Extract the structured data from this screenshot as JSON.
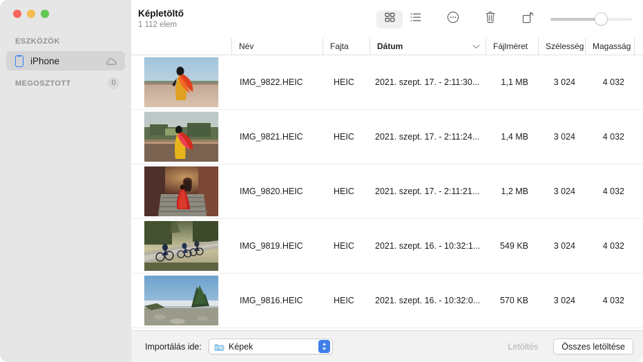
{
  "window": {
    "traffic_lights": [
      "close",
      "minimize",
      "zoom"
    ],
    "title": "Képletöltő",
    "subtitle": "1 112 elem"
  },
  "sidebar": {
    "sections": [
      {
        "label": "ESZKÖZÖK"
      },
      {
        "label": "MEGOSZTOTT",
        "badge": "0"
      }
    ],
    "device": {
      "label": "iPhone",
      "device_icon": "iphone-icon",
      "status_icon": "cloud-icon",
      "selected": true
    }
  },
  "toolbar": {
    "buttons": [
      {
        "name": "grid-view-icon",
        "active": true
      },
      {
        "name": "list-view-icon",
        "active": false
      },
      {
        "name": "more-options-icon",
        "active": false
      },
      {
        "name": "trash-icon",
        "active": false
      },
      {
        "name": "rotate-icon",
        "active": false
      }
    ],
    "zoom_slider": {
      "name": "thumbnail-size-slider",
      "value": 72
    }
  },
  "columns": [
    {
      "key": "thumb",
      "label": "",
      "sorted": false
    },
    {
      "key": "name",
      "label": "Név",
      "sorted": false
    },
    {
      "key": "kind",
      "label": "Fajta",
      "sorted": false
    },
    {
      "key": "date",
      "label": "Dátum",
      "sorted": true
    },
    {
      "key": "size",
      "label": "Fájlméret",
      "sorted": false
    },
    {
      "key": "width",
      "label": "Szélesség",
      "sorted": false
    },
    {
      "key": "height",
      "label": "Magasság",
      "sorted": false
    }
  ],
  "rows": [
    {
      "name": "IMG_9822.HEIC",
      "kind": "HEIC",
      "date": "2021. szept. 17. - 2:11:30...",
      "size": "1,1 MB",
      "width": "3 024",
      "height": "4 032",
      "thumb": "woman-red-sari-on-terrace"
    },
    {
      "name": "IMG_9821.HEIC",
      "kind": "HEIC",
      "date": "2021. szept. 17. - 2:11:24...",
      "size": "1,4 MB",
      "width": "3 024",
      "height": "4 032",
      "thumb": "woman-red-sari-by-garden"
    },
    {
      "name": "IMG_9820.HEIC",
      "kind": "HEIC",
      "date": "2021. szept. 17. - 2:11:21...",
      "size": "1,2 MB",
      "width": "3 024",
      "height": "4 032",
      "thumb": "woman-red-dress-on-stairs"
    },
    {
      "name": "IMG_9819.HEIC",
      "kind": "HEIC",
      "date": "2021. szept. 16. - 10:32:1...",
      "size": "549 KB",
      "width": "3 024",
      "height": "4 032",
      "thumb": "cyclists-on-misty-road"
    },
    {
      "name": "IMG_9816.HEIC",
      "kind": "HEIC",
      "date": "2021. szept. 16. - 10:32:0...",
      "size": "570 KB",
      "width": "3 024",
      "height": "4 032",
      "thumb": "pine-tree-above-clouds"
    }
  ],
  "bottom_bar": {
    "import_label": "Importálás ide:",
    "destination": {
      "icon": "folder-icon",
      "value": "Képek"
    },
    "download_button": {
      "label": "Letöltés",
      "disabled": true
    },
    "download_all_button": {
      "label": "Összes letöltése",
      "disabled": false
    }
  },
  "colors": {
    "accent_blue": "#3e7fe8",
    "device_icon_blue": "#2b7cf7",
    "sidebar_bg": "#e6e6e6",
    "sidebar_selected": "#d5d5d5",
    "bottom_bar_bg": "#f2f2f2"
  }
}
